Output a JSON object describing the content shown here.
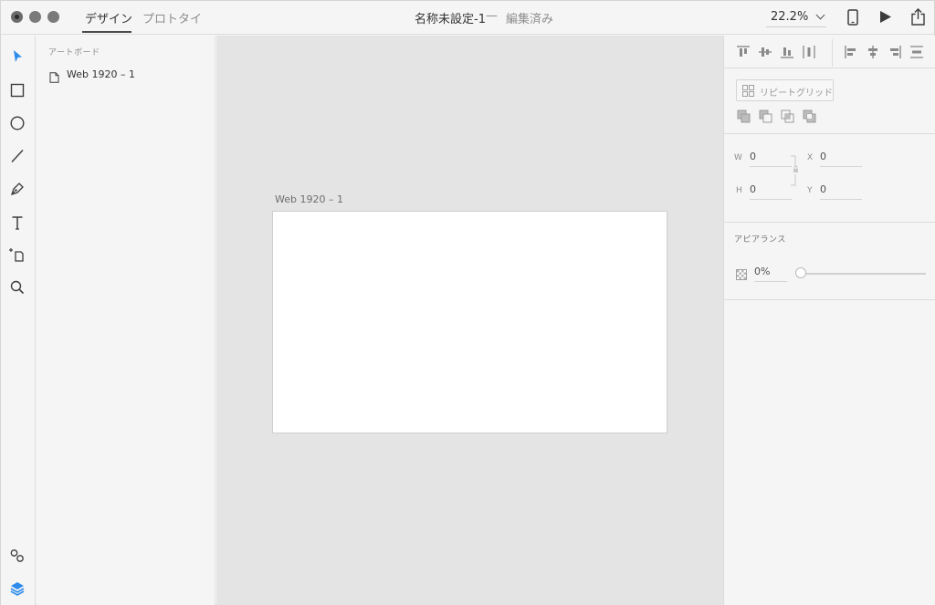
{
  "titlebar": {
    "tabs": [
      {
        "label": "デザイン",
        "active": true
      },
      {
        "label": "プロトタイ",
        "active": false
      }
    ],
    "document_title": "名称未設定-1",
    "separator": "—",
    "status": "編集済み",
    "zoom": "22.2%",
    "icons": [
      "device-preview-icon",
      "play-icon",
      "share-icon"
    ]
  },
  "toolbar": {
    "tools": [
      "select-tool-icon",
      "rectangle-tool-icon",
      "ellipse-tool-icon",
      "line-tool-icon",
      "pen-tool-icon",
      "text-tool-icon",
      "artboard-tool-icon",
      "zoom-tool-icon"
    ],
    "bottom": [
      "assets-icon",
      "layers-icon"
    ],
    "accent_color": "#2d8ceb"
  },
  "layers": {
    "heading": "アートボード",
    "items": [
      {
        "label": "Web 1920 – 1"
      }
    ]
  },
  "canvas": {
    "artboard_label": "Web 1920 – 1",
    "background": "#e4e4e4"
  },
  "inspector": {
    "repeat_grid_label": "リピートグリッド",
    "fields": {
      "w_label": "W",
      "w_value": "0",
      "h_label": "H",
      "h_value": "0",
      "x_label": "X",
      "x_value": "0",
      "y_label": "Y",
      "y_value": "0"
    },
    "appearance": {
      "title": "アピアランス",
      "opacity": "0%",
      "opacity_level": 0
    }
  }
}
